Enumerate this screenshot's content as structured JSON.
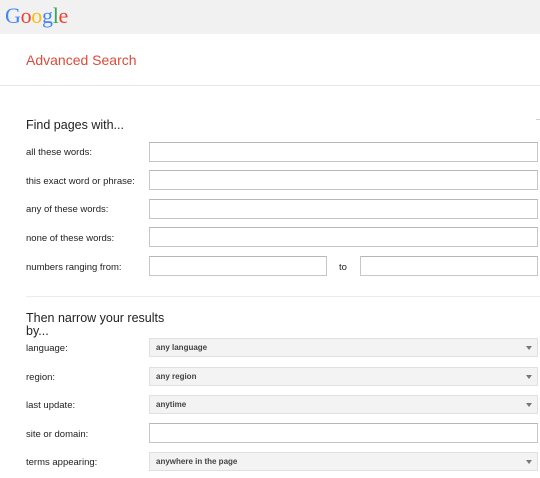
{
  "header": {
    "logo_letters": [
      {
        "char": "G",
        "color": "#4285f4"
      },
      {
        "char": "o",
        "color": "#ea4335"
      },
      {
        "char": "o",
        "color": "#fbbc05"
      },
      {
        "char": "g",
        "color": "#4285f4"
      },
      {
        "char": "l",
        "color": "#34a853"
      },
      {
        "char": "e",
        "color": "#ea4335"
      }
    ],
    "page_title": "Advanced Search"
  },
  "find_section": {
    "title": "Find pages with...",
    "rows": [
      {
        "label": "all these words:",
        "value": ""
      },
      {
        "label": "this exact word or phrase:",
        "value": ""
      },
      {
        "label": "any of these words:",
        "value": ""
      },
      {
        "label": "none of these words:",
        "value": ""
      }
    ],
    "numbers": {
      "label": "numbers ranging from:",
      "from_value": "",
      "to_label": "to",
      "to_value": ""
    }
  },
  "narrow_section": {
    "title_line1": "Then narrow your results",
    "title_line2": "by...",
    "language": {
      "label": "language:",
      "selected": "any language"
    },
    "region": {
      "label": "region:",
      "selected": "any region"
    },
    "last_update": {
      "label": "last update:",
      "selected": "anytime"
    },
    "site": {
      "label": "site or domain:",
      "value": ""
    },
    "terms": {
      "label": "terms appearing:",
      "selected": "anywhere in the page"
    }
  },
  "colors": {
    "title_red": "#dd4b39",
    "topbar": "#f1f1f1"
  }
}
